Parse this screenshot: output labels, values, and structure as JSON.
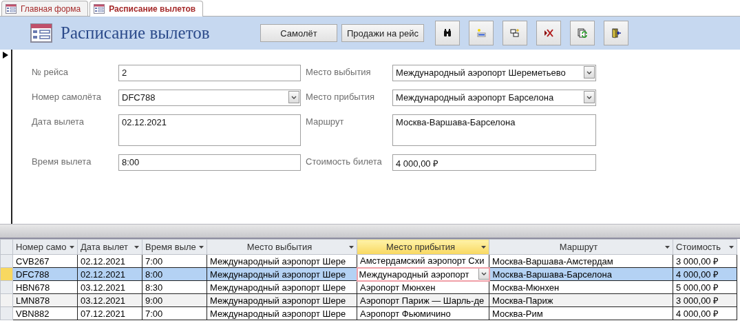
{
  "tabs": [
    {
      "label": "Главная форма",
      "selected": false
    },
    {
      "label": "Расписание вылетов",
      "selected": true
    }
  ],
  "header": {
    "title": "Расписание вылетов",
    "buttons": [
      {
        "label": "Самолёт"
      },
      {
        "label": "Продажи на рейс"
      }
    ],
    "tool_buttons": [
      {
        "kind": "find"
      },
      {
        "kind": "new"
      },
      {
        "kind": "copy"
      },
      {
        "kind": "delete"
      },
      {
        "kind": "refresh"
      },
      {
        "kind": "exit"
      }
    ]
  },
  "form": {
    "left_fields": [
      {
        "label": "№ рейса",
        "value": "2",
        "kind": "text"
      },
      {
        "label": "Номер самолёта",
        "value": "DFC788",
        "kind": "combo"
      },
      {
        "label": "Дата вылета",
        "value": "02.12.2021",
        "kind": "memo"
      },
      {
        "label": "Время вылета",
        "value": "8:00",
        "kind": "text"
      }
    ],
    "right_fields": [
      {
        "label": "Место выбытия",
        "value": "Международный аэропорт Шереметьево",
        "kind": "combo"
      },
      {
        "label": "Место прибытия",
        "value": "Международный аэропорт Барселона",
        "kind": "combo"
      },
      {
        "label": "Маршрут",
        "value": "Москва-Варшава-Барселона",
        "kind": "memo"
      },
      {
        "label": "Стоимость билета",
        "value": "4 000,00 ₽",
        "kind": "text"
      }
    ]
  },
  "datasheet": {
    "columns": [
      {
        "label": "Номер само",
        "selected": false
      },
      {
        "label": "Дата вылет",
        "selected": false
      },
      {
        "label": "Время выле",
        "selected": false
      },
      {
        "label": "Место выбытия",
        "selected": false
      },
      {
        "label": "Место прибытия",
        "selected": true
      },
      {
        "label": "Маршрут",
        "selected": false
      },
      {
        "label": "Стоимость",
        "selected": false
      }
    ],
    "rows": [
      {
        "selected": false,
        "cells": [
          "CVB267",
          "02.12.2021",
          "7:00",
          "Международный аэропорт Шере",
          "Амстердамский аэропорт Схи",
          "Москва-Варшава-Амстердам",
          "3 000,00 ₽"
        ]
      },
      {
        "selected": true,
        "cells": [
          "DFC788",
          "02.12.2021",
          "8:00",
          "Международный аэропорт Шере",
          "Международный аэропорт",
          "Москва-Варшава-Барселона",
          "4 000,00 ₽"
        ]
      },
      {
        "selected": false,
        "cells": [
          "HBN678",
          "03.12.2021",
          "8:30",
          "Международный аэропорт Шере",
          "Аэропорт Мюнхен",
          "Москва-Мюнхен",
          "5 000,00 ₽"
        ]
      },
      {
        "selected": false,
        "cells": [
          "LMN878",
          "03.12.2021",
          "9:00",
          "Международный аэропорт Шере",
          "Аэропорт Париж — Шарль-де",
          "Москва-Париж",
          "3 000,00 ₽"
        ]
      },
      {
        "selected": false,
        "cells": [
          "VBN882",
          "07.12.2021",
          "7:00",
          "Международный аэропорт Шере",
          "Аэропорт Фьюмичино",
          "Москва-Рим",
          "4 000,00 ₽"
        ]
      }
    ]
  }
}
